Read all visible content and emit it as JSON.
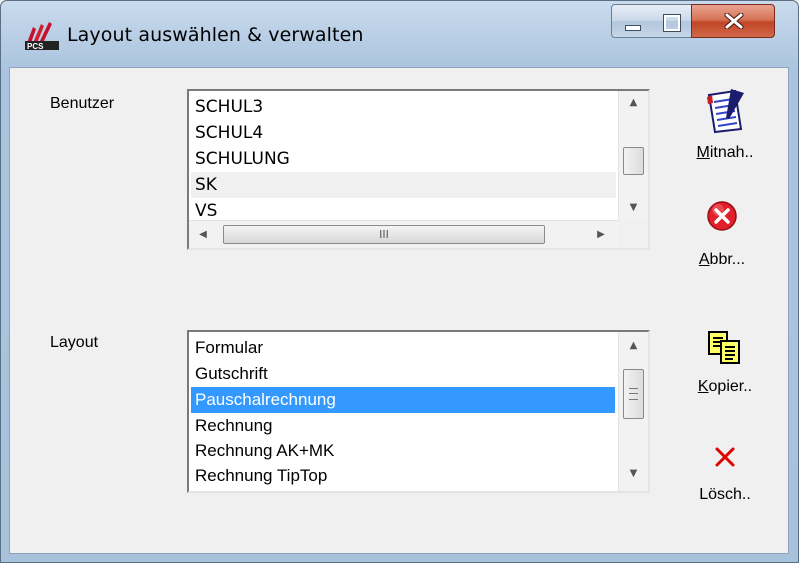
{
  "window": {
    "title": "Layout auswählen & verwalten"
  },
  "benutzer": {
    "label": "Benutzer",
    "items": [
      "SCHUL3",
      "SCHUL4",
      "SCHULUNG",
      "SK",
      "VS"
    ],
    "selected": "SK"
  },
  "layout": {
    "label": "Layout",
    "items": [
      "Formular",
      "Gutschrift",
      "Pauschalrechnung",
      "Rechnung",
      "Rechnung AK+MK",
      "Rechnung TipTop"
    ],
    "selected": "Pauschalrechnung"
  },
  "buttons": {
    "mitnah": {
      "first": "M",
      "rest": "itnah.."
    },
    "abbr": {
      "first": "A",
      "rest": "bbr..."
    },
    "kopier": {
      "first": "K",
      "rest": "opier.."
    },
    "loesch": {
      "label": "Lösch.."
    }
  },
  "colors": {
    "selection": "#3399ff",
    "close_button": "#c24527",
    "cancel_icon": "#e0202a",
    "delete_icon": "#e00000"
  },
  "icons": {
    "app": "pcs-logo-icon",
    "mitnah": "document-pen-icon",
    "abbr": "cancel-circle-icon",
    "kopier": "copy-documents-icon",
    "loesch": "red-x-icon"
  }
}
